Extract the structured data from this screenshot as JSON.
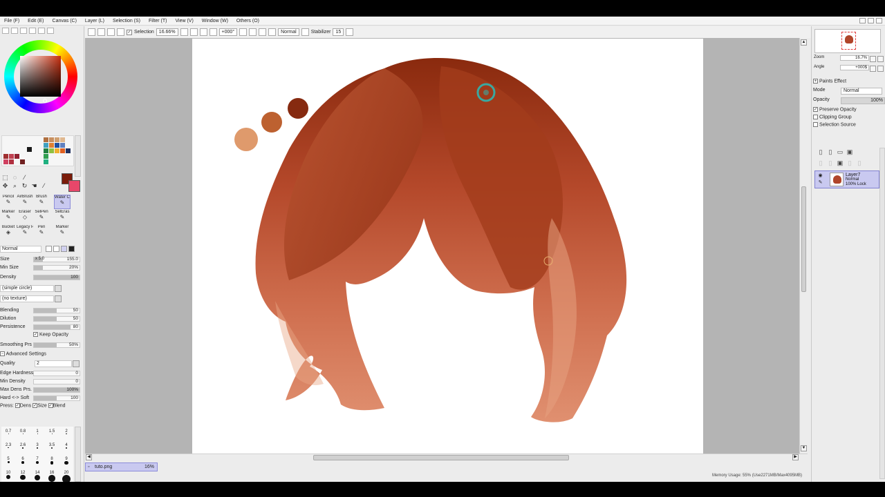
{
  "menu": [
    "File (F)",
    "Edit (E)",
    "Canvas (C)",
    "Layer (L)",
    "Selection (S)",
    "Filter (T)",
    "View (V)",
    "Window (W)",
    "Others (O)"
  ],
  "toolbar": {
    "selection_label": "Selection",
    "zoom_value": "16.66%",
    "angle_value": "+000°",
    "blend_mode": "Normal",
    "stabilizer_label": "Stabilizer",
    "stabilizer_value": "15"
  },
  "tools": {
    "colors": {
      "main": "#7a1c0a",
      "sub": "#e8476a"
    },
    "brushes": [
      {
        "label": "Pencil",
        "icon": "pencil-icon"
      },
      {
        "label": "AirBrush",
        "icon": "airbrush-icon"
      },
      {
        "label": "Brush",
        "icon": "brush-icon"
      },
      {
        "label": "Water Color",
        "icon": "watercolor-icon",
        "active": true
      },
      {
        "label": "Marker",
        "icon": "marker-icon"
      },
      {
        "label": "Eraser",
        "icon": "eraser-icon"
      },
      {
        "label": "SelPen",
        "icon": "selpen-icon"
      },
      {
        "label": "SelEras",
        "icon": "seleras-icon"
      },
      {
        "label": "Bucket",
        "icon": "bucket-icon"
      },
      {
        "label": "Legacy Pen",
        "icon": "legacy-pen-icon"
      },
      {
        "label": "Pen",
        "icon": "pen-icon"
      },
      {
        "label": "Marker",
        "icon": "marker2-icon"
      }
    ]
  },
  "brush_settings": {
    "blend": "Normal",
    "size_label": "Size",
    "size_mult": "x 5.0",
    "size_value": "155.0",
    "min_size_label": "Min Size",
    "min_size_value": "20%",
    "density_label": "Density",
    "density_value": "100",
    "shape": "(simple circle)",
    "texture": "(no texture)",
    "blending_label": "Blending",
    "blending_value": "50",
    "dilution_label": "Dilution",
    "dilution_value": "50",
    "persistence_label": "Persistence",
    "persistence_value": "80",
    "keep_opacity_label": "Keep Opacity",
    "smoothing_label": "Smoothing Prs",
    "smoothing_value": "50%",
    "advanced_label": "Advanced Settings",
    "quality_label": "Quality",
    "quality_value": "2",
    "edge_hardness_label": "Edge Hardness",
    "edge_hardness_value": "0",
    "min_density_label": "Min Density",
    "min_density_value": "0",
    "max_dens_label": "Max Dens Prs.",
    "max_dens_value": "100%",
    "hard_soft_label": "Hard <-> Soft",
    "hard_soft_value": "100",
    "press_label": "Press:",
    "press_dens": "Dens",
    "press_size": "Size",
    "press_blend": "Blend"
  },
  "brush_sizes": [
    "0.7",
    "0.8",
    "1",
    "1.5",
    "2",
    "2.3",
    "2.6",
    "3",
    "3.5",
    "4",
    "5",
    "6",
    "7",
    "8",
    "9",
    "10",
    "12",
    "14",
    "16",
    "20"
  ],
  "document": {
    "tab_name": "tuto.png",
    "tab_zoom": "16%",
    "status": "Memory Usage: 55% (Use2271MB/Max4095MB)"
  },
  "navigator": {
    "zoom_label": "Zoom",
    "zoom_value": "16.7%",
    "angle_label": "Angle",
    "angle_value": "+000$"
  },
  "layer_panel": {
    "paints_effect_label": "Paints Effect",
    "mode_label": "Mode",
    "mode_value": "Normal",
    "opacity_label": "Opacity",
    "opacity_value": "100%",
    "preserve_opacity_label": "Preserve Opacity",
    "clipping_group_label": "Clipping Group",
    "selection_source_label": "Selection Source",
    "layers": [
      {
        "name": "Layer7",
        "mode": "Normal",
        "opacity": "100%",
        "lock": "Lock"
      }
    ]
  }
}
